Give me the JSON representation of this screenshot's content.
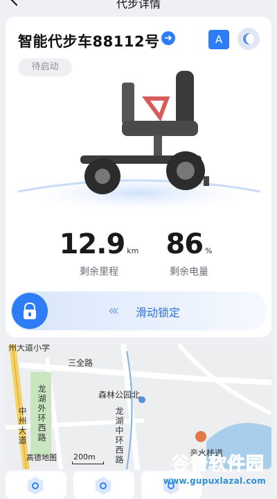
{
  "topbar": {
    "title": "代步详情"
  },
  "vehicle": {
    "name": "智能代步车88112号",
    "status": "待启动",
    "mode_a_label": "A"
  },
  "stats": {
    "range": {
      "value": "12.9",
      "unit": "km",
      "label": "剩余里程"
    },
    "battery": {
      "value": "86",
      "unit": "%",
      "label": "剩余电量"
    }
  },
  "slider": {
    "label": "滑动锁定",
    "chevrons": "‹‹‹"
  },
  "map": {
    "labels": {
      "sanquan_road": "三全路",
      "senlin_park_north": "森林公园北",
      "longhu_outer_west": "龙湖外环西路",
      "longhu_middle_west": "龙湖中环西路",
      "zhongzhou_avenue": "中州大道",
      "top_left_street": "州大道小学",
      "bottom_poi": "亲水栈道"
    },
    "scale": "200m",
    "provider": "高德地图"
  },
  "watermark": {
    "brand": "谷普软件园",
    "url": "www.gupuxlazal.com"
  },
  "colors": {
    "accent": "#2f7df6",
    "text": "#111111",
    "muted": "#6b7079"
  }
}
